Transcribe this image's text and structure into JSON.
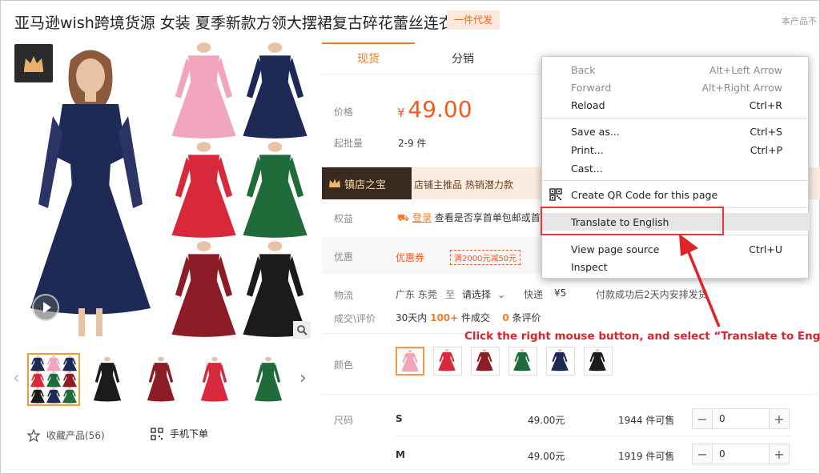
{
  "header": {
    "title": "亚马逊wish跨境货源 女装 夏季新款方领大摆裙复古碎花蕾丝连衣裙",
    "badge": "一件代发",
    "note": "本产品不"
  },
  "gallery": {
    "thumbs": [
      "navy",
      "black",
      "wine",
      "red",
      "green"
    ],
    "favorite_label": "收藏产品(56)",
    "mobile_label": "手机下单"
  },
  "tabs": {
    "spot": "现货",
    "distribution": "分销"
  },
  "price": {
    "label": "价格",
    "currency": "¥",
    "value": "49.00"
  },
  "min_order": {
    "label": "起批量",
    "value": "2-9 件"
  },
  "shop": {
    "tag": "镇店之宝",
    "text": "店铺主推品   热销潜力款"
  },
  "benefits": {
    "label": "权益",
    "link": "登录",
    "text": "查看是否享首单包邮或首单"
  },
  "promo": {
    "label": "优惠",
    "coupon": "优惠券",
    "coupon_tag": "满2000元减50元"
  },
  "logistics": {
    "label": "物流",
    "origin": "广东 东莞",
    "to": "至",
    "select": "请选择",
    "express": "快递",
    "fee": "¥5",
    "delivery": "付款成功后2天内安排发货"
  },
  "deals": {
    "label": "成交\\评价",
    "period": "30天内",
    "count": "100+",
    "count_suffix": "件成交",
    "reviews": "0",
    "reviews_suffix": "条评价"
  },
  "color": {
    "label": "颜色"
  },
  "sizes": {
    "label": "尺码",
    "rows": [
      {
        "size": "S",
        "price": "49.00元",
        "stock": "1944 件可售",
        "qty": "0"
      },
      {
        "size": "M",
        "price": "49.00元",
        "stock": "1919 件可售",
        "qty": "0"
      }
    ]
  },
  "context_menu": {
    "items": [
      {
        "label": "Back",
        "shortcut": "Alt+Left Arrow"
      },
      {
        "label": "Forward",
        "shortcut": "Alt+Right Arrow"
      },
      {
        "label": "Reload",
        "shortcut": "Ctrl+R"
      },
      {
        "label": "Save as...",
        "shortcut": "Ctrl+S"
      },
      {
        "label": "Print...",
        "shortcut": "Ctrl+P"
      },
      {
        "label": "Cast...",
        "shortcut": ""
      },
      {
        "label": "Create QR Code for this page",
        "shortcut": ""
      },
      {
        "label": "Translate to English",
        "shortcut": ""
      },
      {
        "label": "View page source",
        "shortcut": "Ctrl+U"
      },
      {
        "label": "Inspect",
        "shortcut": ""
      }
    ]
  },
  "annotation": "Click the right mouse button, and select “Translate to English”",
  "colors": {
    "accent": "#f07d2b",
    "price": "#f55a1e",
    "annotation": "#e0222a",
    "dress_pink": "#f2a6bd",
    "dress_red": "#d8283c",
    "dress_wine": "#8c1c26",
    "dress_green": "#1f6b3a",
    "dress_navy": "#1c2a55",
    "dress_black": "#1b1b1b"
  }
}
